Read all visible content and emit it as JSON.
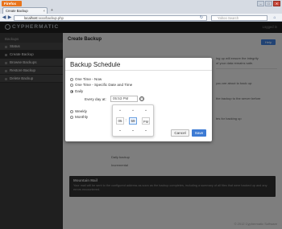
{
  "browser": {
    "app_button": "Firefox",
    "tab_title": "Create Backup",
    "tab_close": "×",
    "new_tab": "+",
    "url_host": "localhost",
    "url_path": ":xxxx/backup.php",
    "search_placeholder": "Yahoo Search",
    "window_controls": {
      "minimize": "–",
      "maximize": "□",
      "close": "✕"
    }
  },
  "app": {
    "logo": "CYPHERMATIC",
    "user_text": "Logged in",
    "footer": "© 2012 Cyphermatic Software"
  },
  "sidebar": {
    "title": "Backups",
    "items": [
      {
        "label": "Status"
      },
      {
        "label": "Create Backup"
      },
      {
        "label": "Browse Backups"
      },
      {
        "label": "Restore Backup"
      },
      {
        "label": "Delete Backup"
      }
    ]
  },
  "main": {
    "title": "Create Backup",
    "help_button": "Help",
    "right_text_1": "ing up will ensure the integrity",
    "right_text_2": "of your data remains safe.",
    "right_text_3": "you are about to back up:",
    "right_text_4": "the backup to the server before",
    "right_text_5": "tes for backing up",
    "row_label_1": "Daily backup",
    "row_label_2": "Incremental",
    "mailbox_title": "Mountain Mail",
    "mailbox_text": "Your mail will be sent to the configured address as soon as the backup completes, including a summary of all files that were backed up and any errors encountered."
  },
  "modal": {
    "title": "Backup Schedule",
    "options": [
      {
        "label": "One Time - Now",
        "selected": false
      },
      {
        "label": "One Time - Specific Date and Time",
        "selected": false
      },
      {
        "label": "Daily",
        "selected": true
      },
      {
        "label": "Weekly",
        "selected": false
      },
      {
        "label": "Monthly",
        "selected": false
      }
    ],
    "every_day_label": "Every day at:",
    "time_value": "05:53 PM",
    "clock_icon": "clock-icon",
    "picker": {
      "hour": "05",
      "minute": "59",
      "meridian": "PM",
      "up_arrow": "⌃",
      "down_arrow": "⌄",
      "colon": ":"
    },
    "cancel_label": "Cancel",
    "save_label": "Save"
  },
  "colors": {
    "accent": "#3d7bd4",
    "header_bg": "#1e1e1e",
    "sidebar_bg": "#3a3a3a",
    "firefox_orange": "#e8741c"
  }
}
